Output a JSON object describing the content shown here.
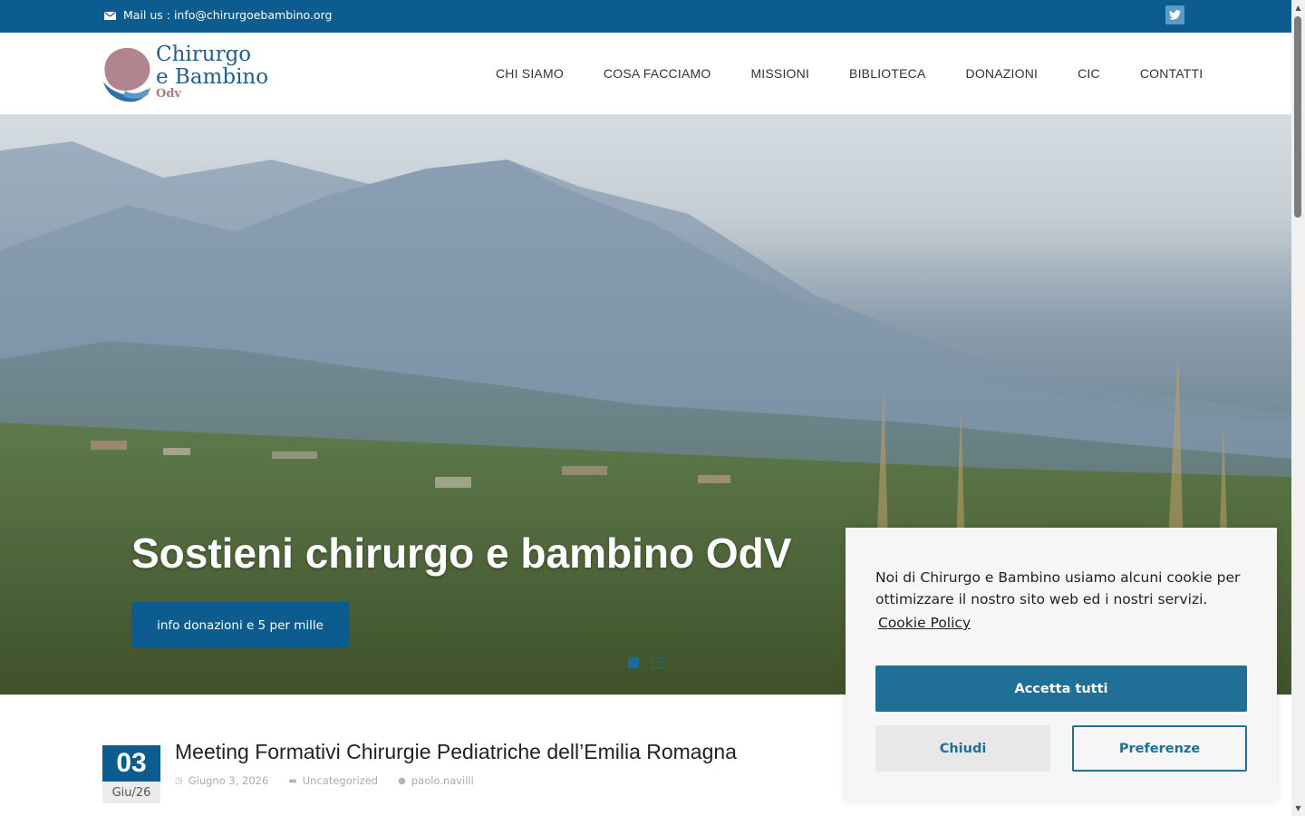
{
  "topbar": {
    "mail_text": "Mail us : info@chirurgoebambino.org",
    "twitter_icon": "twitter-icon"
  },
  "logo": {
    "line1": "Chirurgo",
    "line2": "e Bambino",
    "line3": "Odv"
  },
  "nav": {
    "items": [
      {
        "label": "CHI SIAMO"
      },
      {
        "label": "COSA FACCIAMO"
      },
      {
        "label": "MISSIONI"
      },
      {
        "label": "BIBLIOTECA"
      },
      {
        "label": "DONAZIONI"
      },
      {
        "label": "CIC"
      },
      {
        "label": "CONTATTI"
      }
    ]
  },
  "hero": {
    "title": "Sostieni chirurgo e bambino OdV",
    "button_label": "info donazioni e 5 per mille",
    "active_slide": 1,
    "slide_count": 2
  },
  "post": {
    "day": "03",
    "month_year": "Giu/26",
    "title": "Meeting Formativi Chirurgie Pediatriche dell’Emilia Romagna",
    "date": "Giugno 3, 2026",
    "category": "Uncategorized",
    "author": "paolo.navilli"
  },
  "cookie": {
    "message": "Noi di Chirurgo e Bambino usiamo alcuni cookie per ottimizzare il nostro sito web ed i nostri servizi.",
    "policy_link": "Cookie Policy",
    "accept_label": "Accetta tutti",
    "close_label": "Chiudi",
    "prefs_label": "Preferenze"
  },
  "colors": {
    "brand_blue": "#0d5c8f",
    "cookie_blue": "#1f6f96"
  }
}
